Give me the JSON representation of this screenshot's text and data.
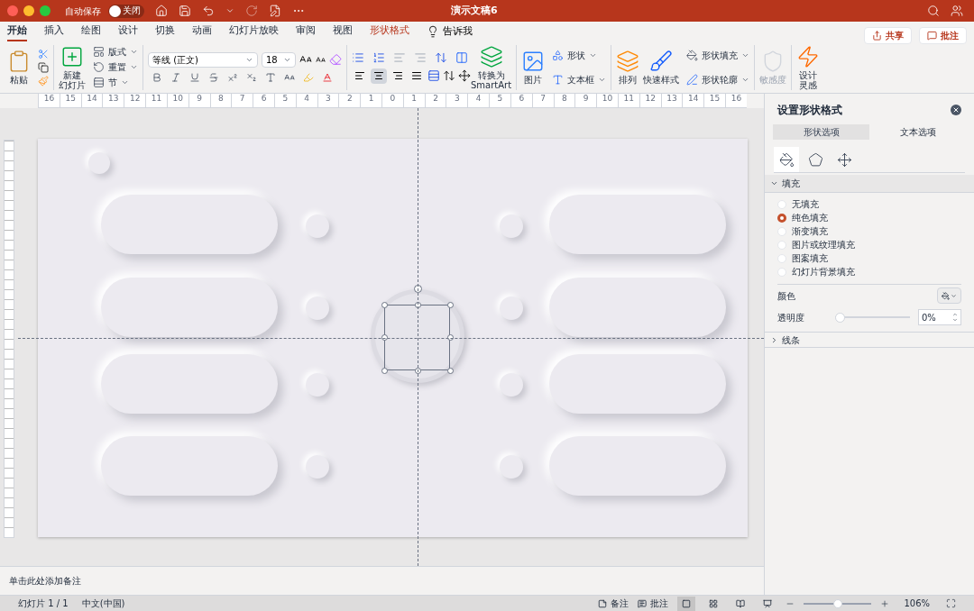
{
  "title_bar": {
    "autosave_label": "自动保存",
    "autosave_toggle": {
      "on": false,
      "label": "关闭"
    },
    "title": "演示文稿6"
  },
  "menu_tabs": [
    {
      "label": "开始",
      "selected": true,
      "kind": "normal"
    },
    {
      "label": "插入",
      "selected": false,
      "kind": "normal"
    },
    {
      "label": "绘图",
      "selected": false,
      "kind": "normal"
    },
    {
      "label": "设计",
      "selected": false,
      "kind": "normal"
    },
    {
      "label": "切换",
      "selected": false,
      "kind": "normal"
    },
    {
      "label": "动画",
      "selected": false,
      "kind": "normal"
    },
    {
      "label": "幻灯片放映",
      "selected": false,
      "kind": "normal"
    },
    {
      "label": "审阅",
      "selected": false,
      "kind": "normal"
    },
    {
      "label": "视图",
      "selected": false,
      "kind": "normal"
    },
    {
      "label": "形状格式",
      "selected": false,
      "kind": "contextual"
    }
  ],
  "tell_me": "告诉我",
  "share": "共享",
  "comments": "批注",
  "ribbon": {
    "paste": "粘贴",
    "new_slide": [
      "新建",
      "幻灯片"
    ],
    "slide_items": [
      "版式",
      "重置",
      "节"
    ],
    "font": "等线 (正文)",
    "font_size": "18",
    "alignment": [
      {
        "kind": "left",
        "selected": false
      },
      {
        "kind": "center",
        "selected": true
      },
      {
        "kind": "right",
        "selected": false
      },
      {
        "kind": "justify",
        "selected": false
      }
    ],
    "smartart": "转换为\nSmartArt",
    "picture": "图片",
    "shape": "形状",
    "textbox": "文本框",
    "arrange": "排列",
    "quick_styles": "快速样式",
    "shape_fill": "形状填充",
    "shape_outline": "形状轮廓",
    "sensitivity": {
      "label": "敏感度",
      "disabled": true
    },
    "designer": [
      "设计",
      "灵感"
    ]
  },
  "ruler_labels": [
    "16",
    "15",
    "14",
    "13",
    "12",
    "11",
    "10",
    "9",
    "8",
    "7",
    "6",
    "5",
    "4",
    "3",
    "2",
    "1",
    "0",
    "1",
    "2",
    "3",
    "4",
    "5",
    "6",
    "7",
    "8",
    "9",
    "10",
    "11",
    "12",
    "13",
    "14",
    "15",
    "16"
  ],
  "format_pane": {
    "title": "设置形状格式",
    "tabs": [
      {
        "label": "形状选项",
        "selected": true
      },
      {
        "label": "文本选项",
        "selected": false
      }
    ],
    "icon_tabs": [
      {
        "kind": "fill",
        "selected": true
      },
      {
        "kind": "effects",
        "selected": false
      },
      {
        "kind": "size",
        "selected": false
      }
    ],
    "fill": {
      "label": "填充",
      "expanded": true,
      "options": [
        {
          "label": "无填充",
          "selected": false
        },
        {
          "label": "纯色填充",
          "selected": true
        },
        {
          "label": "渐变填充",
          "selected": false
        },
        {
          "label": "图片或纹理填充",
          "selected": false
        },
        {
          "label": "图案填充",
          "selected": false
        },
        {
          "label": "幻灯片背景填充",
          "selected": false
        }
      ],
      "color_label": "颜色",
      "transparency": {
        "label": "透明度",
        "level": 0,
        "value": "0%"
      }
    },
    "line": {
      "label": "线条",
      "expanded": false
    }
  },
  "notes_placeholder": "单击此处添加备注",
  "status_bar": {
    "slide": "幻灯片 1 / 1",
    "language": "中文(中国)",
    "notes": "备注",
    "comments": "批注",
    "views": [
      {
        "kind": "normal",
        "selected": true
      },
      {
        "kind": "sorter",
        "selected": false
      },
      {
        "kind": "reading",
        "selected": false
      },
      {
        "kind": "show",
        "selected": false
      }
    ],
    "zoom": {
      "level": 0.5,
      "value": "106%"
    }
  }
}
